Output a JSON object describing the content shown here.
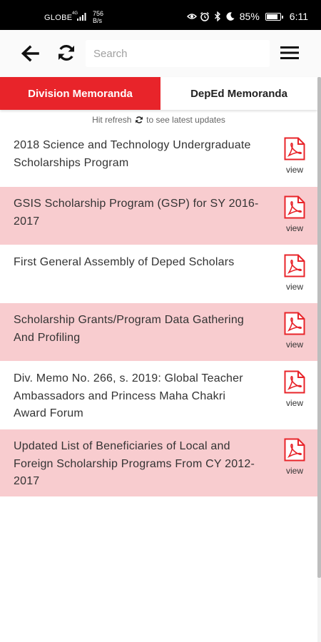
{
  "status_bar": {
    "carrier": "GLOBE",
    "network_type": "4G",
    "speed_value": "756",
    "speed_unit": "B/s",
    "battery_percent": "85%",
    "time": "6:11",
    "icons": [
      "eye-comfort-icon",
      "alarm-icon",
      "bluetooth-icon",
      "do-not-disturb-icon"
    ]
  },
  "toolbar": {
    "back_icon": "back-arrow-icon",
    "refresh_icon": "refresh-icon",
    "search_placeholder": "Search",
    "search_value": "",
    "menu_icon": "hamburger-menu-icon"
  },
  "tabs": [
    {
      "label": "Division Memoranda",
      "active": true
    },
    {
      "label": "DepEd Memoranda",
      "active": false
    }
  ],
  "hint": {
    "prefix": "Hit refresh",
    "suffix": "to see latest updates"
  },
  "items": [
    {
      "title": "2018 Science and Technology Undergraduate Scholarships Program",
      "view_label": "view"
    },
    {
      "title": "GSIS Scholarship Program (GSP) for SY 2016-2017",
      "view_label": "view"
    },
    {
      "title": "First General Assembly of Deped Scholars",
      "view_label": "view"
    },
    {
      "title": "Scholarship Grants/Program Data Gathering And Profiling",
      "view_label": "view"
    },
    {
      "title": "Div. Memo No. 266, s. 2019: Global Teacher Ambassadors and Princess Maha Chakri Award Forum",
      "view_label": "view"
    },
    {
      "title": "Updated List of Beneficiaries of Local and Foreign Scholarship Programs From CY 2012-2017",
      "view_label": "view"
    }
  ],
  "colors": {
    "accent": "#e8242a",
    "row_alt": "#f8cccf",
    "pdf_icon": "#e8242a"
  }
}
